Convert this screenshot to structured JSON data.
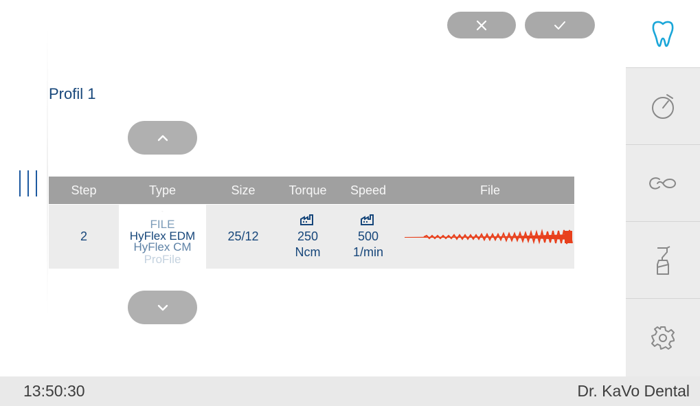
{
  "header": {
    "cancel_icon": "close-icon",
    "confirm_icon": "check-icon"
  },
  "profile": {
    "title": "Profil 1"
  },
  "table": {
    "columns": [
      "Step",
      "Type",
      "Size",
      "Torque",
      "Speed",
      "File"
    ],
    "row": {
      "step": "2",
      "type_options": [
        "FILE",
        "HyFlex EDM",
        "HyFlex CM",
        "ProFile"
      ],
      "type_selected": "HyFlex EDM",
      "size": "25/12",
      "torque_value": "250",
      "torque_unit": "Ncm",
      "speed_value": "500",
      "speed_unit": "1/min",
      "factory_icon": "factory-icon"
    }
  },
  "sidebar": {
    "items": [
      "tooth-icon",
      "timer-icon",
      "loop-icon",
      "spray-bottle-icon",
      "settings-gear-icon"
    ]
  },
  "status": {
    "time": "13:50:30",
    "user": "Dr. KaVo Dental"
  },
  "colors": {
    "accent": "#16467a",
    "icon_blue": "#1aa6d8",
    "file_red": "#e8401c",
    "button_gray": "#a9a9a9"
  }
}
